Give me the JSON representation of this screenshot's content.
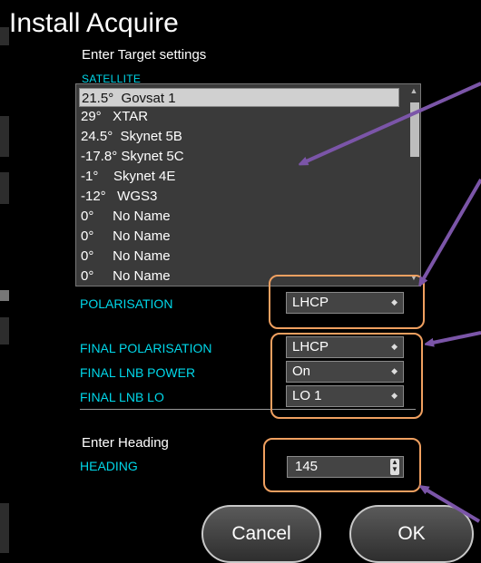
{
  "window": {
    "title": "Install Acquire"
  },
  "target": {
    "subtitle": "Enter Target settings",
    "satellite_label": "SATELLITE",
    "satellites": [
      "21.5°  Govsat 1",
      "29°   XTAR",
      "24.5°  Skynet 5B",
      "-17.8° Skynet 5C",
      "-1°    Skynet 4E",
      "-12°   WGS3",
      "0°     No Name",
      "0°     No Name",
      "0°     No Name",
      "0°     No Name"
    ],
    "selected_index": 0,
    "polarisation_label": "POLARISATION",
    "polarisation_value": "LHCP",
    "final_polarisation_label": "FINAL POLARISATION",
    "final_polarisation_value": "LHCP",
    "final_lnb_power_label": "FINAL LNB POWER",
    "final_lnb_power_value": "On",
    "final_lnb_lo_label": "FINAL LNB LO",
    "final_lnb_lo_value": "LO 1"
  },
  "heading": {
    "subtitle": "Enter Heading",
    "label": "HEADING",
    "value": "145"
  },
  "buttons": {
    "cancel": "Cancel",
    "ok": "OK"
  },
  "colors": {
    "background": "#000000",
    "accent_label": "#00d8ea",
    "callout": "#f0a060",
    "arrow": "#7b55a8"
  },
  "icons": [
    "arrow-annotation-icon",
    "select-arrow-icon",
    "spin-arrows-icon"
  ]
}
